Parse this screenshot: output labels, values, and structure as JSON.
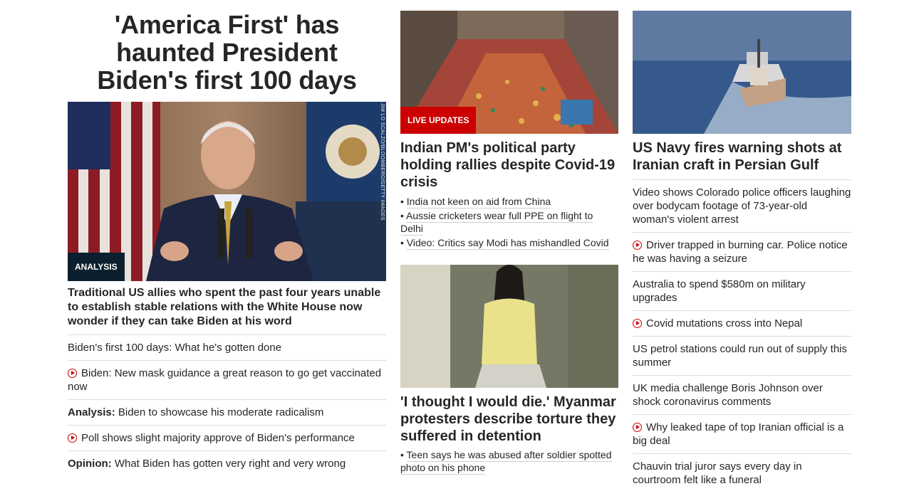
{
  "colors": {
    "red": "#cc0000",
    "dark": "#0c1f2e",
    "text": "#262626"
  },
  "col1": {
    "headline": "'America First' has haunted President Biden's first 100 days",
    "badge": "ANALYSIS",
    "photo_credit": "JIM LO SCALZO/BLOOMBERG/GETTY IMAGES",
    "subhead": "Traditional US allies who spent the past four years unable to establish stable relations with the White House now wonder if they can take Biden at his word",
    "items": [
      {
        "prefix": "",
        "video": false,
        "text": "Biden's first 100 days: What he's gotten done"
      },
      {
        "prefix": "",
        "video": true,
        "text": "Biden: New mask guidance a great reason to go get vaccinated now"
      },
      {
        "prefix": "Analysis:",
        "video": false,
        "text": "Biden to showcase his moderate radicalism"
      },
      {
        "prefix": "",
        "video": true,
        "text": "Poll shows slight majority approve of Biden's performance"
      },
      {
        "prefix": "Opinion:",
        "video": false,
        "text": "What Biden has gotten very right and very wrong"
      }
    ]
  },
  "col2": {
    "story1": {
      "badge": "LIVE UPDATES",
      "headline": "Indian PM's political party holding rallies despite Covid-19 crisis",
      "bullets": [
        "India not keen on aid from China",
        "Aussie cricketers wear full PPE on flight to Delhi",
        "Video: Critics say Modi has mishandled Covid"
      ]
    },
    "story2": {
      "headline": "'I thought I would die.' Myanmar protesters describe torture they suffered in detention",
      "bullets": [
        "Teen says he was abused after soldier spotted photo on his phone"
      ]
    }
  },
  "col3": {
    "headline": "US Navy fires warning shots at Iranian craft in Persian Gulf",
    "items": [
      {
        "video": false,
        "text": "Video shows Colorado police officers laughing over bodycam footage of 73-year-old woman's violent arrest"
      },
      {
        "video": true,
        "text": "Driver trapped in burning car. Police notice he was having a seizure"
      },
      {
        "video": false,
        "text": "Australia to spend $580m on military upgrades"
      },
      {
        "video": true,
        "text": "Covid mutations cross into Nepal"
      },
      {
        "video": false,
        "text": "US petrol stations could run out of supply this summer"
      },
      {
        "video": false,
        "text": "UK media challenge Boris Johnson over shock coronavirus comments"
      },
      {
        "video": true,
        "text": "Why leaked tape of top Iranian official is a big deal"
      },
      {
        "video": false,
        "text": "Chauvin trial juror says every day in courtroom felt like a funeral"
      }
    ]
  }
}
